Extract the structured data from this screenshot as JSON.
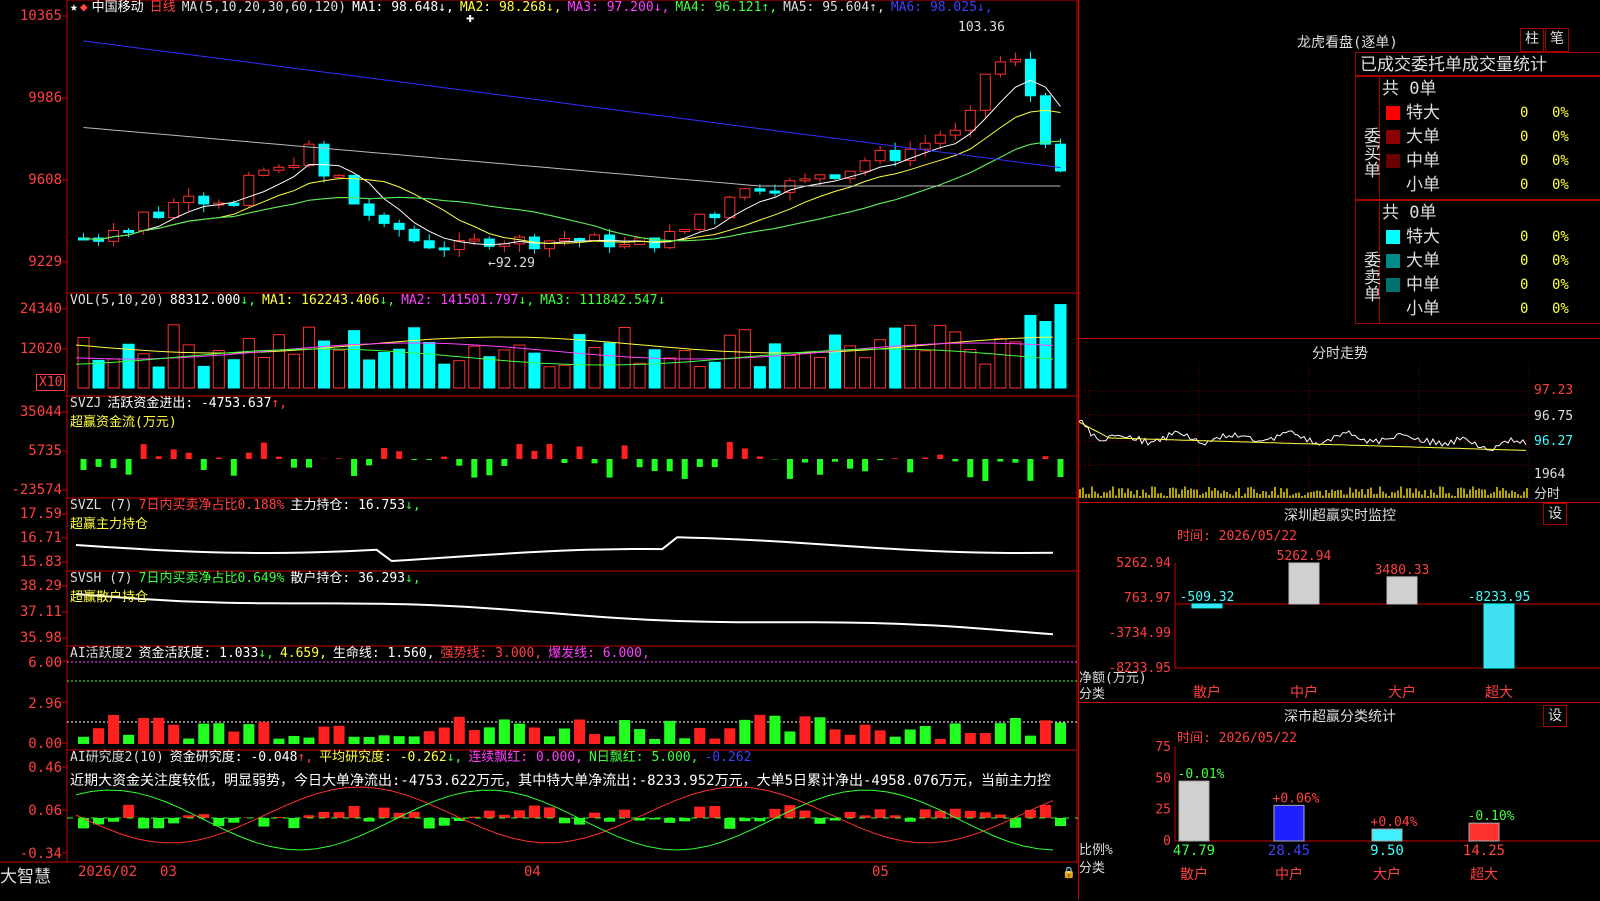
{
  "stock": {
    "name": "中国移动",
    "period": "日线",
    "ma_label": "MA(5,10,20,30,60,120)",
    "ma": [
      {
        "label": "MA1:",
        "value": "98.648",
        "arrow": "↓",
        "color": "#ffffff"
      },
      {
        "label": "MA2:",
        "value": "98.268",
        "arrow": "↓",
        "color": "#ffff40"
      },
      {
        "label": "MA3:",
        "value": "97.200",
        "arrow": "↓",
        "color": "#ff40ff"
      },
      {
        "label": "MA4:",
        "value": "96.121",
        "arrow": "↑",
        "color": "#40ff40"
      },
      {
        "label": "MA5:",
        "value": "95.604",
        "arrow": "↑",
        "color": "#dddddd"
      },
      {
        "label": "MA6:",
        "value": "98.025",
        "arrow": "↓",
        "color": "#4040ff"
      }
    ],
    "high_label": "103.36",
    "low_label": "←92.29",
    "price_axis": [
      "10365",
      "9986",
      "9608",
      "9229"
    ]
  },
  "volume": {
    "label": "VOL(5,10,20)",
    "value": "88312.000",
    "ma1": "MA1: 162243.406",
    "ma2": "MA2: 141501.797",
    "ma3": "MA3: 111842.547",
    "axis": [
      "24340",
      "12020"
    ],
    "unit": "X10"
  },
  "svzj": {
    "label": "SVZJ",
    "desc": "活跃资金进出: -4753.637",
    "subtitle": "超赢资金流(万元)",
    "axis": [
      "35044",
      "5735",
      "-23574"
    ]
  },
  "svzl": {
    "label": "SVZL (7)",
    "desc_green": "7日内买卖净占比0.188%",
    "desc": "主力持仓: 16.753",
    "subtitle": "超赢主力持仓",
    "axis": [
      "17.59",
      "16.71",
      "15.83"
    ]
  },
  "svsh": {
    "label": "SVSH (7)",
    "desc_green": "7日内买卖净占比0.649%",
    "desc": "散户持仓: 36.293",
    "subtitle": "超赢散户持仓",
    "axis": [
      "38.29",
      "37.11",
      "35.98"
    ]
  },
  "ai_active": {
    "label": "AI活跃度2",
    "v1": "资金活跃度: 1.033",
    "v2": "4.659,",
    "v3": "生命线: 1.560,",
    "v4": "强势线: 3.000,",
    "v5": "爆发线: 6.000,",
    "axis": [
      "6.00",
      "2.96",
      "0.00"
    ]
  },
  "ai_research": {
    "label": "AI研究度2(10)",
    "v1": "资金研究度: -0.048",
    "v2": "平均研究度: -0.262",
    "v3": "连续飘红: 0.000,",
    "v4": "N日飘红: 5.000,",
    "v5": "-0.262",
    "note": "近期大资金关注度较低，明显弱势，今日大单净流出:-4753.622万元，其中特大单净流出:-8233.952万元，大单5日累计净出-4958.076万元，当前主力控",
    "axis": [
      "0.46",
      "0.06",
      "-0.34"
    ]
  },
  "xaxis": {
    "start": "2026/02",
    "m1": "03",
    "m2": "04",
    "m3": "05"
  },
  "brand": "大智慧",
  "right": {
    "lhb_title": "龙虎看盘(逐单)",
    "btn_zhu": "柱",
    "btn_bi": "笔",
    "tabs": "已成交委托单成交量统计",
    "buy_label": "委买单",
    "sell_label": "委卖单",
    "buy_total": "共 0单",
    "sell_total": "共 0单",
    "buy_rows": [
      {
        "name": "特大",
        "count": "0",
        "pct": "0%",
        "color": "#ff0000"
      },
      {
        "name": "大单",
        "count": "0",
        "pct": "0%",
        "color": "#8b0000"
      },
      {
        "name": "中单",
        "count": "0",
        "pct": "0%",
        "color": "#6b0000"
      },
      {
        "name": "小单",
        "count": "0",
        "pct": "0%",
        "color": "#000000"
      }
    ],
    "sell_rows": [
      {
        "name": "特大",
        "count": "0",
        "pct": "0%",
        "color": "#00ffff"
      },
      {
        "name": "大单",
        "count": "0",
        "pct": "0%",
        "color": "#008b8b"
      },
      {
        "name": "中单",
        "count": "0",
        "pct": "0%",
        "color": "#007070"
      },
      {
        "name": "小单",
        "count": "0",
        "pct": "0%",
        "color": "#000000"
      }
    ],
    "fs_title": "分时走势",
    "fs_axis": [
      "97.23",
      "96.75",
      "96.27",
      "1964",
      "分时"
    ],
    "sz_title": "深圳超赢实时监控",
    "sz_set": "设",
    "sz_time": "时间: 2026/05/22",
    "sz_axis": [
      "5262.94",
      "763.97",
      "-3734.99",
      "-8233.95"
    ],
    "sz_bar_labels": [
      "-509.32",
      "5262.94",
      "3480.33",
      "-8233.95"
    ],
    "sz_y_label": "净额(万元)",
    "sz_x_label": "分类",
    "sz_cats": [
      "散户",
      "中户",
      "大户",
      "超大"
    ],
    "cls_title": "深市超赢分类统计",
    "cls_set": "设",
    "cls_time": "时间: 2026/05/22",
    "cls_axis": [
      "75",
      "50",
      "25",
      "0"
    ],
    "cls_top": [
      "-0.01%",
      "+0.06%",
      "+0.04%",
      "-0.10%"
    ],
    "cls_vals": [
      "47.79",
      "28.45",
      "9.50",
      "14.25"
    ],
    "cls_y_label": "比例%",
    "cls_x_label": "分类",
    "cls_cats": [
      "散户",
      "中户",
      "大户",
      "超大"
    ]
  },
  "chart_data": [
    {
      "type": "bar",
      "title": "深圳超赢实时监控",
      "categories": [
        "散户",
        "中户",
        "大户",
        "超大"
      ],
      "values": [
        -509.32,
        5262.94,
        3480.33,
        -8233.95
      ],
      "ylim": [
        -8233.95,
        5262.94
      ]
    },
    {
      "type": "bar",
      "title": "深市超赢分类统计",
      "categories": [
        "散户",
        "中户",
        "大户",
        "超大"
      ],
      "values": [
        47.79,
        28.45,
        9.5,
        14.25
      ],
      "ylim": [
        0,
        75
      ]
    }
  ]
}
